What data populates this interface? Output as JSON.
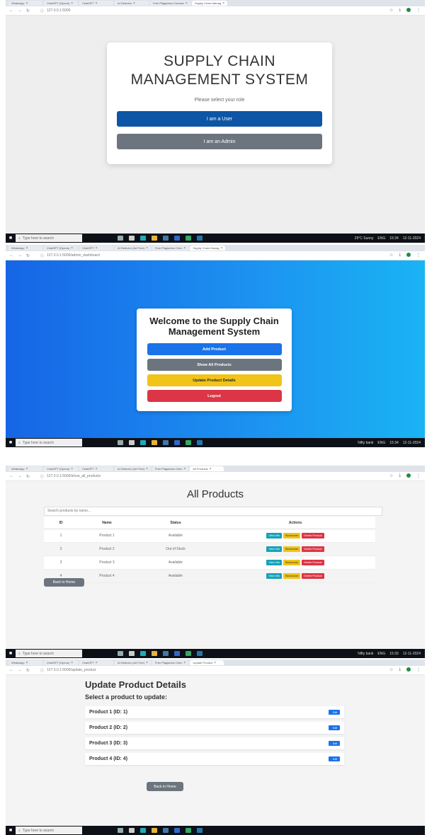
{
  "shot1": {
    "tabs": [
      {
        "label": "WhatsApp"
      },
      {
        "label": "ChatGPT (Opens)"
      },
      {
        "label": "ChatGPT"
      },
      {
        "label": "AI Detector"
      },
      {
        "label": "Free Plagiarism Checker"
      },
      {
        "label": "Supply Chain Manag"
      }
    ],
    "url": "127.0.0.1:5000",
    "title": "SUPPLY CHAIN MANAGEMENT SYSTEM",
    "subtitle": "Please select your role",
    "user_button": "I am a User",
    "admin_button": "I am an Admin",
    "taskbar": {
      "search_placeholder": "Type here to search",
      "weather": "29°C Sunny",
      "lang": "ENG",
      "time": "15:34",
      "date": "12-11-2024"
    }
  },
  "shot2": {
    "tabs": [
      {
        "label": "WhatsApp"
      },
      {
        "label": "ChatGPT (Opens)"
      },
      {
        "label": "ChatGPT"
      },
      {
        "label": "AI Detector (Ad Free)"
      },
      {
        "label": "Free Plagiarism Chec"
      },
      {
        "label": "Supply Chain Manag"
      }
    ],
    "url": "127.0.0.1:5000/admin_dashboard",
    "title": "Welcome to the Supply Chain Management System",
    "buttons": {
      "add": "Add Product",
      "show_all": "Show All Products",
      "update": "Update Product Details",
      "logout": "Logout"
    },
    "taskbar": {
      "search_placeholder": "Type here to search",
      "news": "Nifty bank",
      "lang": "ENG",
      "time": "15:34",
      "date": "12-11-2024"
    }
  },
  "shot3": {
    "tabs": [
      {
        "label": "WhatsApp"
      },
      {
        "label": "ChatGPT (Opens)"
      },
      {
        "label": "ChatGPT"
      },
      {
        "label": "AI Detector (Ad Free)"
      },
      {
        "label": "Free Plagiarism Chec"
      },
      {
        "label": "All Products"
      }
    ],
    "url": "127.0.0.1:5000/show_all_products",
    "title": "All Products",
    "search_placeholder": "Search products by name...",
    "columns": [
      "ID",
      "Name",
      "Status",
      "Actions"
    ],
    "rows": [
      {
        "id": "1",
        "name": "Product 1",
        "status": "Available"
      },
      {
        "id": "2",
        "name": "Product 2",
        "status": "Out of Stock"
      },
      {
        "id": "3",
        "name": "Product 3",
        "status": "Available"
      },
      {
        "id": "4",
        "name": "Product 4",
        "status": "Available"
      }
    ],
    "actions": {
      "view": "View Info",
      "blockchain": "Blockchain",
      "delete": "Delete Product"
    },
    "back_button": "Back to Home",
    "taskbar": {
      "search_placeholder": "Type here to search",
      "news": "Nifty bank",
      "lang": "ENG",
      "time": "15:33",
      "date": "12-11-2024"
    }
  },
  "shot4": {
    "tabs": [
      {
        "label": "WhatsApp"
      },
      {
        "label": "ChatGPT (Opens)"
      },
      {
        "label": "ChatGPT"
      },
      {
        "label": "AI Detector (Ad Free)"
      },
      {
        "label": "Free Plagiarism Chec"
      },
      {
        "label": "Update Product"
      }
    ],
    "url": "127.0.0.1:5000/update_product",
    "title": "Update Product Details",
    "subtitle": "Select a product to update:",
    "items": [
      {
        "label": "Product 1 (ID: 1)"
      },
      {
        "label": "Product 2 (ID: 2)"
      },
      {
        "label": "Product 3 (ID: 3)"
      },
      {
        "label": "Product 4 (ID: 4)"
      }
    ],
    "edit_label": "Edit",
    "back_button": "Back to Home",
    "taskbar": {
      "search_placeholder": "Type here to search"
    }
  },
  "colors": {
    "primary_blue": "#0d56a6",
    "gray": "#6c757d",
    "bright_blue": "#1a73e8",
    "yellow": "#f0c419",
    "red": "#dc3545",
    "teal": "#17a2b8"
  },
  "icons": [
    "back-arrow-icon",
    "forward-arrow-icon",
    "reload-icon",
    "info-icon",
    "star-icon",
    "download-icon",
    "profile-icon",
    "menu-icon",
    "windows-start-icon",
    "search-icon"
  ]
}
